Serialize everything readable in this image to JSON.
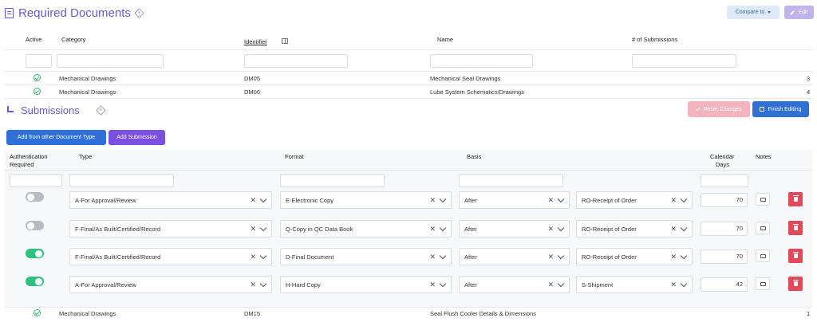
{
  "header": {
    "title": "Required Documents",
    "compare_label": "Compare to",
    "edit_label": "Edit"
  },
  "docs_table": {
    "columns": {
      "active": "Active",
      "category": "Category",
      "identifier": "Identifier",
      "name": "Name",
      "submissions": "# of Submissions"
    },
    "rows": [
      {
        "category": "Mechanical Drawings",
        "identifier": "DM05",
        "name": "Mechanical Seal Drawings",
        "count": "3"
      },
      {
        "category": "Mechanical Drawings",
        "identifier": "DM06",
        "name": "Lube System Schematics/Drawings",
        "count": "4"
      }
    ],
    "bottom_row": {
      "category": "Mechanical Drawings",
      "identifier": "DM15",
      "name": "Seal Flush Cooler Details & Dimensions",
      "count": "1"
    }
  },
  "submissions": {
    "title": "Submissions",
    "reset_label": "Reset Changes",
    "finish_label": "Finish Editing",
    "add_from_label": "Add from other Document Type",
    "add_submission_label": "Add Submission",
    "columns": {
      "auth_line1": "Authentication",
      "auth_line2": "Required",
      "type": "Type",
      "format": "Format",
      "basis": "Basis",
      "days_line1": "Calendar",
      "days_line2": "Days",
      "notes": "Notes"
    },
    "rows": [
      {
        "auth": "off",
        "type": "A-For Approval/Review",
        "format": "E-Electronic Copy",
        "basis": "After",
        "event": "RO-Receipt of Order",
        "days": "70"
      },
      {
        "auth": "off",
        "type": "F-Final/As Built/Certified/Record",
        "format": "Q-Copy in QC Data Book",
        "basis": "After",
        "event": "RO-Receipt of Order",
        "days": "70"
      },
      {
        "auth": "on",
        "type": "F-Final/As Built/Certified/Record",
        "format": "D-Final Document",
        "basis": "After",
        "event": "RO-Receipt of Order",
        "days": "70"
      },
      {
        "auth": "on",
        "type": "A-For Approval/Review",
        "format": "H-Hard Copy",
        "basis": "After",
        "event": "S-Shipment",
        "days": "42"
      }
    ]
  },
  "colors": {
    "accent": "#6a5acd",
    "primary": "#2f6fd6",
    "purple": "#7b4fe0",
    "danger": "#e24a5c",
    "success": "#2ec27e"
  }
}
